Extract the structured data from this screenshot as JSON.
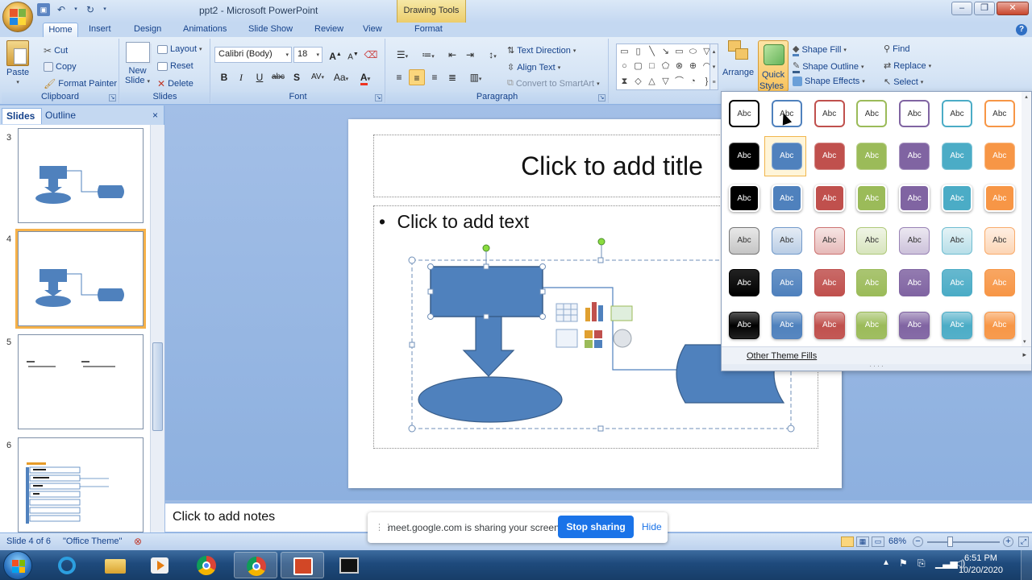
{
  "window": {
    "title": "ppt2 - Microsoft PowerPoint",
    "context_tab_group": "Drawing Tools",
    "controls": [
      "–",
      "❐",
      "✕"
    ]
  },
  "tabs": [
    "Home",
    "Insert",
    "Design",
    "Animations",
    "Slide Show",
    "Review",
    "View",
    "Format"
  ],
  "ribbon": {
    "clipboard": {
      "label": "Clipboard",
      "paste": "Paste",
      "cut": "Cut",
      "copy": "Copy",
      "format_painter": "Format Painter"
    },
    "slides": {
      "label": "Slides",
      "new_slide": "New",
      "new_slide2": "Slide",
      "layout": "Layout",
      "reset": "Reset",
      "delete": "Delete"
    },
    "font": {
      "label": "Font",
      "font_name": "Calibri (Body)",
      "font_size": "18",
      "bold": "B",
      "italic": "I",
      "underline": "U",
      "strike": "abc",
      "shadow": "S",
      "spacing": "AV",
      "case": "Aa",
      "color": "A",
      "grow": "A",
      "shrink": "A"
    },
    "paragraph": {
      "label": "Paragraph",
      "text_direction": "Text Direction",
      "align_text": "Align Text",
      "convert_smartart": "Convert to SmartArt"
    },
    "drawing": {
      "arrange": "Arrange",
      "quick_styles": "Quick",
      "quick_styles2": "Styles",
      "shape_fill": "Shape Fill",
      "shape_outline": "Shape Outline",
      "shape_effects": "Shape Effects"
    },
    "editing": {
      "find": "Find",
      "replace": "Replace",
      "select": "Select"
    }
  },
  "left_panel": {
    "tab_slides": "Slides",
    "tab_outline": "Outline",
    "close": "×",
    "thumbnails": [
      {
        "number": "3",
        "selected": false
      },
      {
        "number": "4",
        "selected": true
      },
      {
        "number": "5",
        "selected": false
      },
      {
        "number": "6",
        "selected": false
      }
    ]
  },
  "slide": {
    "title_placeholder": "Click to add title",
    "content_placeholder": "Click to add text",
    "bullet": "•"
  },
  "notes": {
    "placeholder": "Click to add notes"
  },
  "status": {
    "slide_info": "Slide 4 of 6",
    "theme": "\"Office Theme\"",
    "zoom": "68%"
  },
  "quick_styles": {
    "cell_label": "Abc",
    "rows": [
      [
        "outline-black",
        "outline-blue",
        "outline-red",
        "outline-green",
        "outline-purple",
        "outline-aqua",
        "outline-orange"
      ],
      [
        "fill-black",
        "fill-blue",
        "fill-red",
        "fill-green",
        "fill-purple",
        "fill-aqua",
        "fill-orange"
      ],
      [
        "light-black",
        "light-blue",
        "light-red",
        "light-green",
        "light-purple",
        "light-aqua",
        "light-orange"
      ],
      [
        "pastel-black",
        "pastel-blue",
        "pastel-red",
        "pastel-green",
        "pastel-purple",
        "pastel-aqua",
        "pastel-orange"
      ],
      [
        "intense-black",
        "intense-blue",
        "intense-red",
        "intense-green",
        "intense-purple",
        "intense-aqua",
        "intense-orange"
      ],
      [
        "glossy-black",
        "glossy-blue",
        "glossy-red",
        "glossy-green",
        "glossy-purple",
        "glossy-aqua",
        "glossy-orange"
      ]
    ],
    "theme_colors": [
      "#000000",
      "#4f81bd",
      "#c0504d",
      "#9bbb59",
      "#8064a2",
      "#4bacc6",
      "#f79646"
    ],
    "selected": "fill-blue",
    "other_theme_fills": "Other Theme Fills"
  },
  "share_banner": {
    "text": "meet.google.com is sharing your screen.",
    "stop": "Stop sharing",
    "hide": "Hide"
  },
  "taskbar": {
    "time": "6:51 PM",
    "date": "10/20/2020"
  },
  "colors": {
    "shape_fill": "#4f81bd",
    "shape_stroke": "#385d8a"
  }
}
